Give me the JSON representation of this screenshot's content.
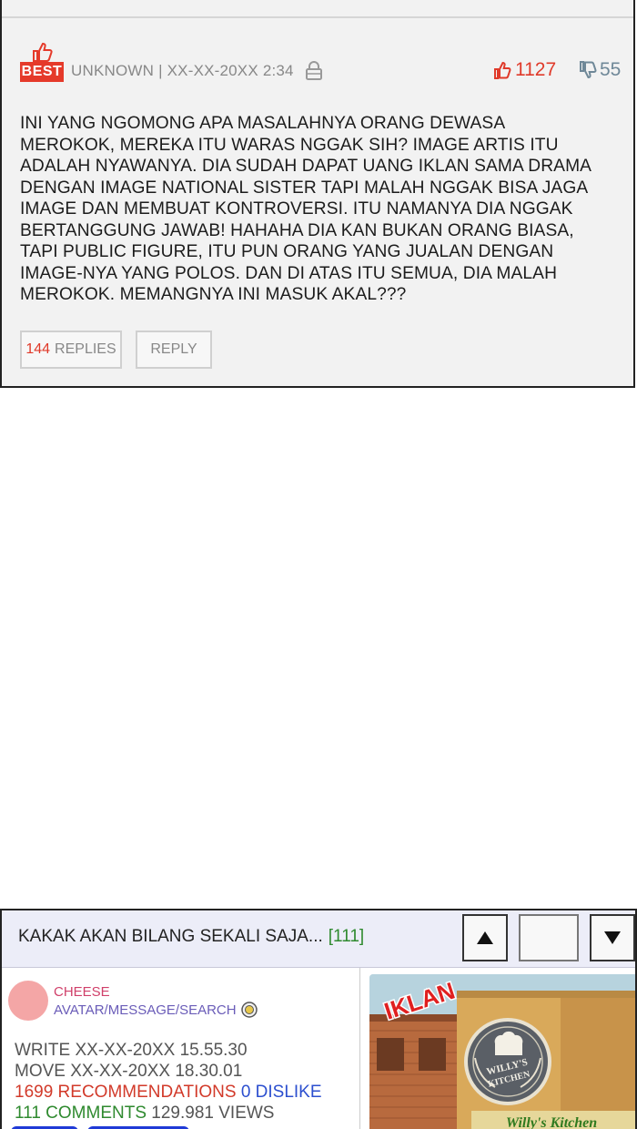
{
  "comment": {
    "badge_label": "BEST",
    "author": "UNKNOWN",
    "separator": "|",
    "timestamp": "XX-XX-20XX 2:34",
    "likes": "1127",
    "dislikes": "55",
    "body": "INI YANG NGOMONG APA MASALAHNYA ORANG DEWASA\nMEROKOK, MEREKA ITU WARAS NGGAK SIH? IMAGE ARTIS ITU\nADALAH NYAWANYA. DIA SUDAH DAPAT UANG IKLAN SAMA DRAMA\nDENGAN IMAGE NATIONAL SISTER TAPI MALAH NGGAK BISA JAGA\nIMAGE DAN MEMBUAT KONTROVERSI. ITU NAMANYA DIA NGGAK\nBERTANGGUNG JAWAB! HAHAHA DIA KAN BUKAN ORANG BIASA,\nTAPI PUBLIC FIGURE, ITU PUN ORANG YANG JUALAN DENGAN\nIMAGE-NYA YANG POLOS. DAN DI ATAS ITU SEMUA, DIA MALAH\nMEROKOK. MEMANGNYA INI MASUK AKAL???",
    "replies_count": "144",
    "replies_label": "REPLIES",
    "reply_label": "REPLY",
    "accent_color": "#e53a2a"
  },
  "post": {
    "title": "KAKAK AKAN BILANG SEKALI SAJA...",
    "comment_count": "[111]",
    "author": "CHEESE",
    "author_links": "AVATAR/MESSAGE/SEARCH",
    "write_label": "WRITE",
    "write_time": "XX-XX-20XX 15.55.30",
    "move_label": "MOVE",
    "move_time": "XX-XX-20XX 18.30.01",
    "recommendations": "1699 RECOMMENDATIONS",
    "dislike": "0 DISLIKE",
    "comments": "111 COMMENTS",
    "views": "129.981 VIEWS",
    "ad": {
      "label": "IKLAN",
      "sign_top": "WILLY'S",
      "sign_bottom": "KITCHEN",
      "storefront_text": "Willy's Kitchen"
    },
    "icons": [
      "thumbs-up-icon",
      "lock-icon",
      "thumbs-down-icon",
      "arrow-up-icon",
      "arrow-down-icon",
      "coin-icon"
    ],
    "header_color": "#ecedf8"
  }
}
